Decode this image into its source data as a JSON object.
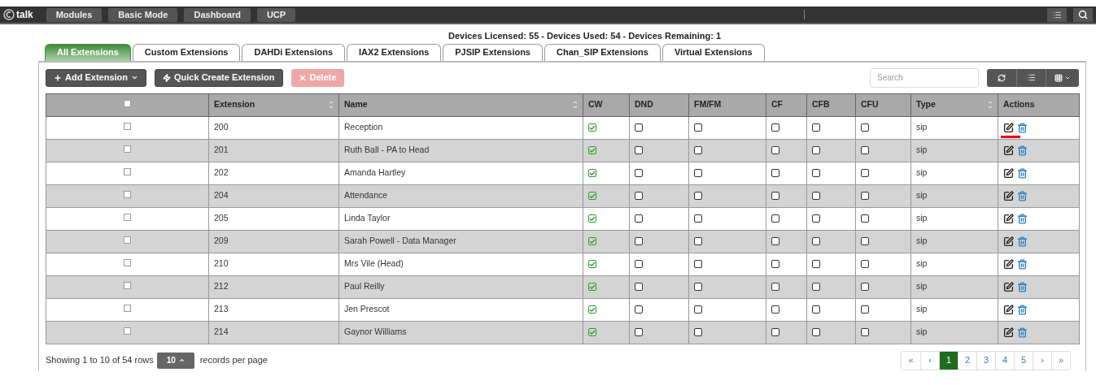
{
  "topbar": {
    "logo_text": "talk",
    "buttons": [
      "Modules",
      "Basic Mode",
      "Dashboard",
      "UCP"
    ]
  },
  "license": "Devices Licensed: 55 - Devices Used: 54 - Devices Remaining: 1",
  "tabs": [
    {
      "label": "All Extensions",
      "selected": true
    },
    {
      "label": "Custom Extensions",
      "selected": false
    },
    {
      "label": "DAHDi Extensions",
      "selected": false
    },
    {
      "label": "IAX2 Extensions",
      "selected": false
    },
    {
      "label": "PJSIP Extensions",
      "selected": false
    },
    {
      "label": "Chan_SIP Extensions",
      "selected": false
    },
    {
      "label": "Virtual Extensions",
      "selected": false
    }
  ],
  "toolbar": {
    "buttons": [
      {
        "kind": "add",
        "label": "Add Extension",
        "disabled": false
      },
      {
        "kind": "quick",
        "label": "Quick Create Extension",
        "disabled": false
      },
      {
        "kind": "delete",
        "label": "Delete",
        "disabled": true
      }
    ],
    "search": {
      "placeholder": "Search"
    }
  },
  "table": {
    "header_checked": false,
    "columns": [
      {
        "label": "Extension",
        "sortable": true
      },
      {
        "label": "Name",
        "sortable": true
      },
      {
        "label": "CW",
        "sortable": false
      },
      {
        "label": "DND",
        "sortable": false
      },
      {
        "label": "FM/FM",
        "sortable": false
      },
      {
        "label": "CF",
        "sortable": false
      },
      {
        "label": "CFB",
        "sortable": false
      },
      {
        "label": "CFU",
        "sortable": false
      },
      {
        "label": "Type",
        "sortable": true
      },
      {
        "label": "Actions",
        "sortable": false
      }
    ],
    "rows": [
      {
        "checked": false,
        "extension": "200",
        "name": "Reception",
        "cw": true,
        "dnd": false,
        "fmfm": false,
        "cf": false,
        "cfb": false,
        "cfu": false,
        "type": "sip",
        "edit_marked": true
      },
      {
        "checked": false,
        "extension": "201",
        "name": "Ruth Ball - PA to Head",
        "cw": true,
        "dnd": false,
        "fmfm": false,
        "cf": false,
        "cfb": false,
        "cfu": false,
        "type": "sip",
        "edit_marked": false
      },
      {
        "checked": false,
        "extension": "202",
        "name": "Amanda Hartley",
        "cw": true,
        "dnd": false,
        "fmfm": false,
        "cf": false,
        "cfb": false,
        "cfu": false,
        "type": "sip",
        "edit_marked": false
      },
      {
        "checked": false,
        "extension": "204",
        "name": "Attendance",
        "cw": true,
        "dnd": false,
        "fmfm": false,
        "cf": false,
        "cfb": false,
        "cfu": false,
        "type": "sip",
        "edit_marked": false
      },
      {
        "checked": false,
        "extension": "205",
        "name": "Linda Taylor",
        "cw": true,
        "dnd": false,
        "fmfm": false,
        "cf": false,
        "cfb": false,
        "cfu": false,
        "type": "sip",
        "edit_marked": false
      },
      {
        "checked": false,
        "extension": "209",
        "name": "Sarah Powell - Data Manager",
        "cw": true,
        "dnd": false,
        "fmfm": false,
        "cf": false,
        "cfb": false,
        "cfu": false,
        "type": "sip",
        "edit_marked": false
      },
      {
        "checked": false,
        "extension": "210",
        "name": "Mrs Vile (Head)",
        "cw": true,
        "dnd": false,
        "fmfm": false,
        "cf": false,
        "cfb": false,
        "cfu": false,
        "type": "sip",
        "edit_marked": false
      },
      {
        "checked": false,
        "extension": "212",
        "name": "Paul Reilly",
        "cw": true,
        "dnd": false,
        "fmfm": false,
        "cf": false,
        "cfb": false,
        "cfu": false,
        "type": "sip",
        "edit_marked": false
      },
      {
        "checked": false,
        "extension": "213",
        "name": "Jen Prescot",
        "cw": true,
        "dnd": false,
        "fmfm": false,
        "cf": false,
        "cfb": false,
        "cfu": false,
        "type": "sip",
        "edit_marked": false
      },
      {
        "checked": false,
        "extension": "214",
        "name": "Gaynor Williams",
        "cw": true,
        "dnd": false,
        "fmfm": false,
        "cf": false,
        "cfb": false,
        "cfu": false,
        "type": "sip",
        "edit_marked": false
      }
    ]
  },
  "footer": {
    "showing": "Showing 1 to 10 of 54 rows",
    "page_size": "10",
    "per_page": "records per page",
    "pagination": [
      {
        "label": "«",
        "selected": false
      },
      {
        "label": "‹",
        "selected": false
      },
      {
        "label": "1",
        "selected": true
      },
      {
        "label": "2",
        "selected": false
      },
      {
        "label": "3",
        "selected": false
      },
      {
        "label": "4",
        "selected": false
      },
      {
        "label": "5",
        "selected": false
      },
      {
        "label": "›",
        "selected": false
      },
      {
        "label": "»",
        "selected": false
      }
    ]
  }
}
